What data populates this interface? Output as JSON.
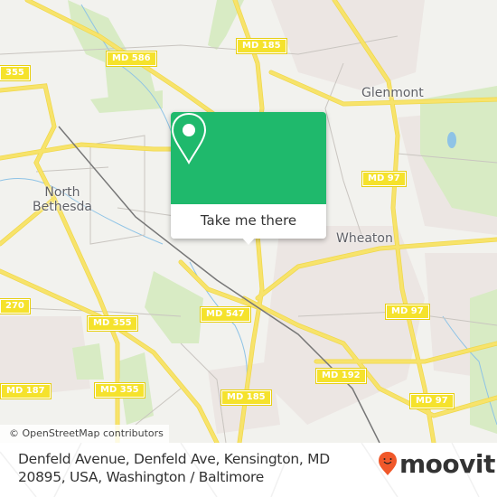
{
  "map": {
    "attribution": "© OpenStreetMap contributors",
    "colors": {
      "background": "#f2f2ee",
      "road": "#f7e36b",
      "park": "#d8ebc4",
      "urban": "#ece6e3",
      "water": "#8ec3e6",
      "rail": "#777777"
    },
    "place_labels": [
      {
        "name": "Glenmont"
      },
      {
        "name": "North\nBethesda"
      },
      {
        "name": "Wheaton"
      }
    ],
    "road_shields": [
      {
        "label": "MD 586"
      },
      {
        "label": "MD 185"
      },
      {
        "label": "MD 97"
      },
      {
        "label": "MD 355"
      },
      {
        "label": "270"
      },
      {
        "label": "MD 547"
      },
      {
        "label": "MD 97"
      },
      {
        "label": "MD 355"
      },
      {
        "label": "MD 187"
      },
      {
        "label": "MD 185"
      },
      {
        "label": "MD 192"
      },
      {
        "label": "MD 97"
      },
      {
        "label": "355"
      }
    ],
    "popup": {
      "icon": "map-pin-icon",
      "button_label": "Take me there",
      "color": "#1fb96c"
    }
  },
  "footer": {
    "address": "Denfeld Avenue, Denfeld Ave, Kensington, MD 20895, USA, Washington / Baltimore",
    "brand": "moovit",
    "brand_icon": "moovit-smiley-pin-icon",
    "brand_icon_color": "#f0582a"
  }
}
